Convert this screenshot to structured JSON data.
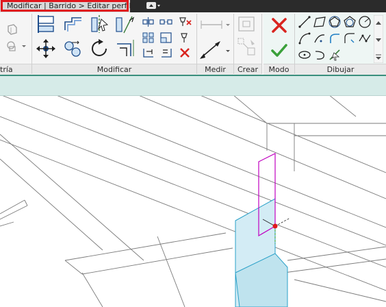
{
  "title_bar": {
    "context_title": "Modificar | Barrido > Editar perfil"
  },
  "ribbon": {
    "panels": {
      "geometry_partial": "tría",
      "modify": "Modificar",
      "measure": "Medir",
      "create": "Crear",
      "mode": "Modo",
      "draw": "Dibujar"
    }
  },
  "colors": {
    "highlight_box": "#e0161c",
    "options_bar": "#d6ebe8",
    "profile_sketch": "#c000c0",
    "selection_face": "#bfe3ee",
    "cancel_red": "#d9241f",
    "finish_green": "#3aa03a"
  }
}
